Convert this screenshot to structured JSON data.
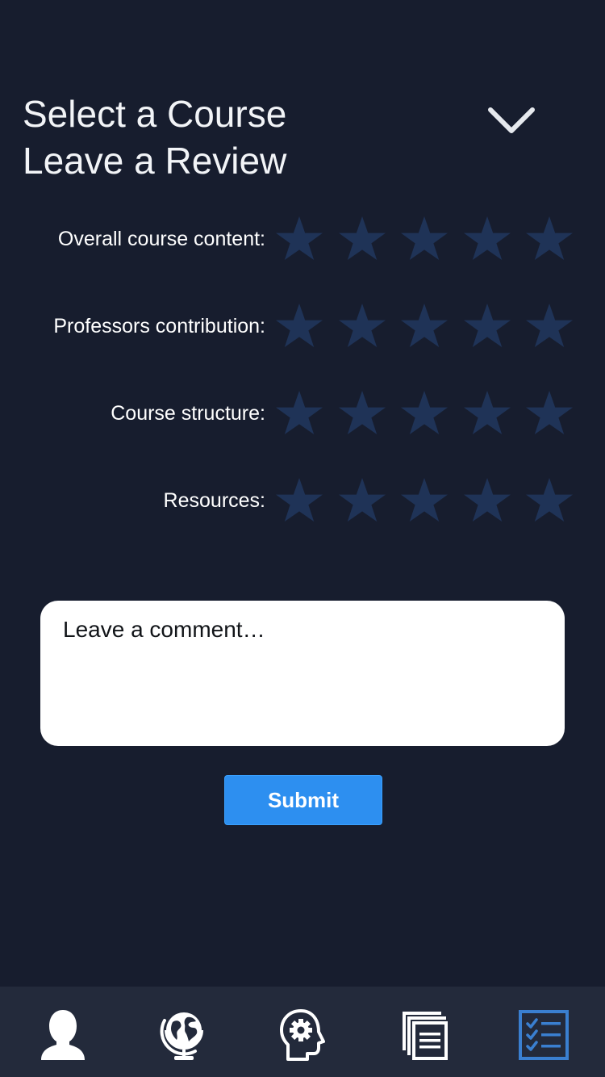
{
  "header": {
    "title_line1": "Select a Course",
    "title_line2": "Leave a Review",
    "dropdown_icon": "chevron-down-icon"
  },
  "ratings": [
    {
      "label": "Overall course content:",
      "max_stars": 5,
      "selected": 0
    },
    {
      "label": "Professors contribution:",
      "max_stars": 5,
      "selected": 0
    },
    {
      "label": "Course structure:",
      "max_stars": 5,
      "selected": 0
    },
    {
      "label": "Resources:",
      "max_stars": 5,
      "selected": 0
    }
  ],
  "comment": {
    "placeholder": "Leave a comment…"
  },
  "submit": {
    "label": "Submit"
  },
  "tabbar": {
    "tabs": [
      {
        "icon": "user-icon",
        "active": false
      },
      {
        "icon": "globe-icon",
        "active": false
      },
      {
        "icon": "head-gear-icon",
        "active": false
      },
      {
        "icon": "documents-icon",
        "active": false
      },
      {
        "icon": "checklist-icon",
        "active": true
      }
    ]
  },
  "colors": {
    "background": "#171d2e",
    "tabbar_background": "#232a3b",
    "star_empty": "#1f3357",
    "submit_button": "#2d8ff0",
    "active_tab": "#3a7fd0"
  }
}
